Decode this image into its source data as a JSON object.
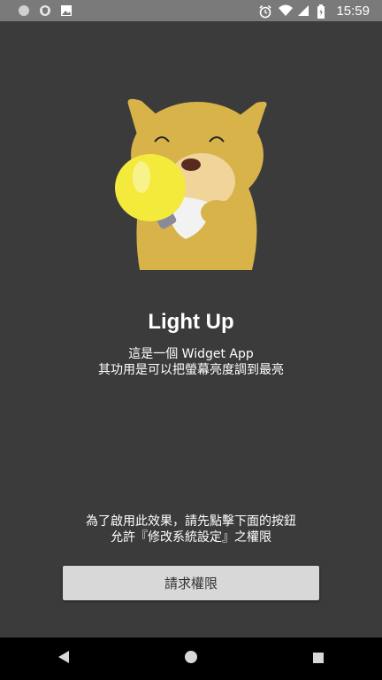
{
  "status_bar": {
    "time": "15:59",
    "left_icons": [
      "circle-icon",
      "shield-icon",
      "image-icon"
    ],
    "right_icons": [
      "alarm-icon",
      "wifi-icon",
      "signal-icon",
      "battery-icon"
    ]
  },
  "app": {
    "title": "Light Up",
    "description_line1": "這是一個 Widget App",
    "description_line2": "其功用是可以把螢幕亮度調到最亮",
    "hint_line1": "為了啟用此效果，請先點擊下面的按鈕",
    "hint_line2": "允許『修改系統設定』之權限",
    "button_label": "請求權限"
  },
  "nav_bar": {
    "buttons": [
      "back-icon",
      "home-icon",
      "recents-icon"
    ]
  },
  "colors": {
    "background": "#3b3b3b",
    "status_bar": "#7a7a7a",
    "mascot": "#d8b34a",
    "bulb": "#f4ea3c",
    "button": "#d8d8d8"
  }
}
